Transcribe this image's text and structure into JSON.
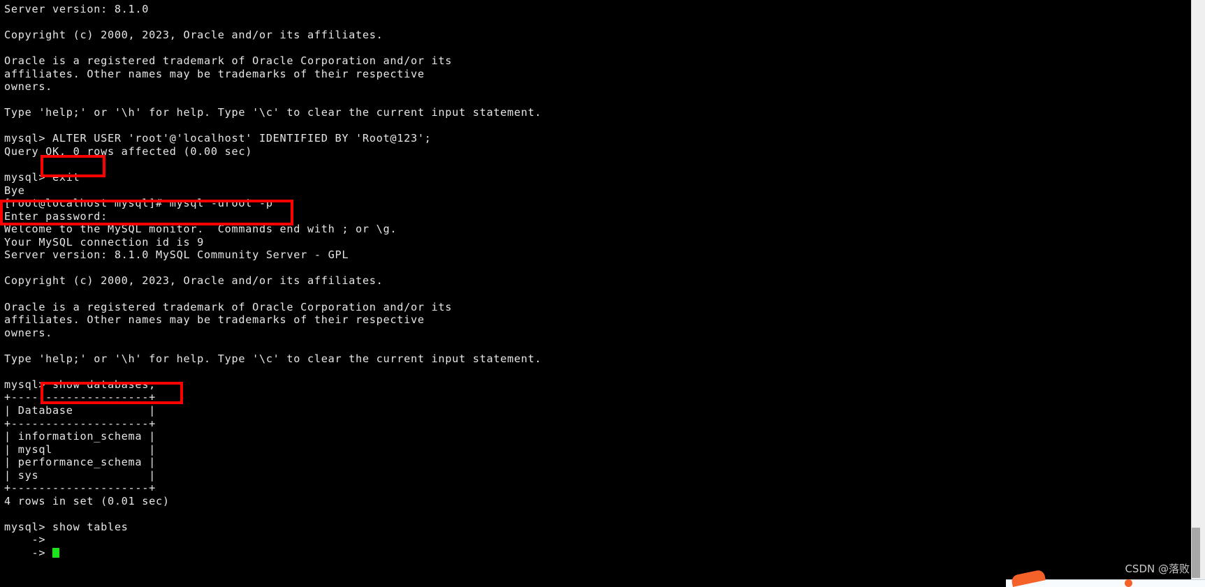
{
  "terminal": {
    "background_color": "#000000",
    "text_color": "#e6e6e6",
    "cursor_color": "#19e519",
    "highlight_color": "#ff0000",
    "lines": [
      "Server version: 8.1.0",
      "",
      "Copyright (c) 2000, 2023, Oracle and/or its affiliates.",
      "",
      "Oracle is a registered trademark of Oracle Corporation and/or its",
      "affiliates. Other names may be trademarks of their respective",
      "owners.",
      "",
      "Type 'help;' or '\\h' for help. Type '\\c' to clear the current input statement.",
      "",
      "mysql> ALTER USER 'root'@'localhost' IDENTIFIED BY 'Root@123';",
      "Query OK, 0 rows affected (0.00 sec)",
      "",
      "mysql> exit",
      "Bye",
      "[root@localhost mysql]# mysql -uroot -p",
      "Enter password:",
      "Welcome to the MySQL monitor.  Commands end with ; or \\g.",
      "Your MySQL connection id is 9",
      "Server version: 8.1.0 MySQL Community Server - GPL",
      "",
      "Copyright (c) 2000, 2023, Oracle and/or its affiliates.",
      "",
      "Oracle is a registered trademark of Oracle Corporation and/or its",
      "affiliates. Other names may be trademarks of their respective",
      "owners.",
      "",
      "Type 'help;' or '\\h' for help. Type '\\c' to clear the current input statement.",
      "",
      "mysql> show databases;",
      "+--------------------+",
      "| Database           |",
      "+--------------------+",
      "| information_schema |",
      "| mysql              |",
      "| performance_schema |",
      "| sys                |",
      "+--------------------+",
      "4 rows in set (0.01 sec)",
      "",
      "mysql> show tables",
      "    ->",
      "    -> "
    ]
  },
  "highlights": [
    {
      "name": "exit-command",
      "text": "exit"
    },
    {
      "name": "mysql-login-command",
      "text": "[root@localhost mysql]# mysql -uroot -p / Enter password:"
    },
    {
      "name": "show-databases-command",
      "text": "show databases;"
    }
  ],
  "commands": {
    "alter_user": "ALTER USER 'root'@'localhost' IDENTIFIED BY 'Root@123';",
    "exit": "exit",
    "login": "mysql -uroot -p",
    "show_databases": "show databases;",
    "show_tables": "show tables"
  },
  "prompts": {
    "mysql": "mysql>",
    "shell": "[root@localhost mysql]#",
    "continuation": "    ->",
    "password": "Enter password:"
  },
  "query_result": {
    "type": "table",
    "column_header": "Database",
    "rows": [
      "information_schema",
      "mysql",
      "performance_schema",
      "sys"
    ],
    "footer": "4 rows in set (0.01 sec)",
    "alter_footer": "Query OK, 0 rows affected (0.00 sec)"
  },
  "server_info": {
    "version": "8.1.0",
    "full_version": "8.1.0 MySQL Community Server - GPL",
    "connection_id": "9",
    "welcome": "Welcome to the MySQL monitor.  Commands end with ; or \\g.",
    "copyright": "Copyright (c) 2000, 2023, Oracle and/or its affiliates.",
    "trademark": "Oracle is a registered trademark of Oracle Corporation and/or its affiliates. Other names may be trademarks of their respective owners.",
    "help_hint": "Type 'help;' or '\\h' for help. Type '\\c' to clear the current input statement.",
    "bye": "Bye"
  },
  "watermark": {
    "text": "CSDN @落败"
  }
}
